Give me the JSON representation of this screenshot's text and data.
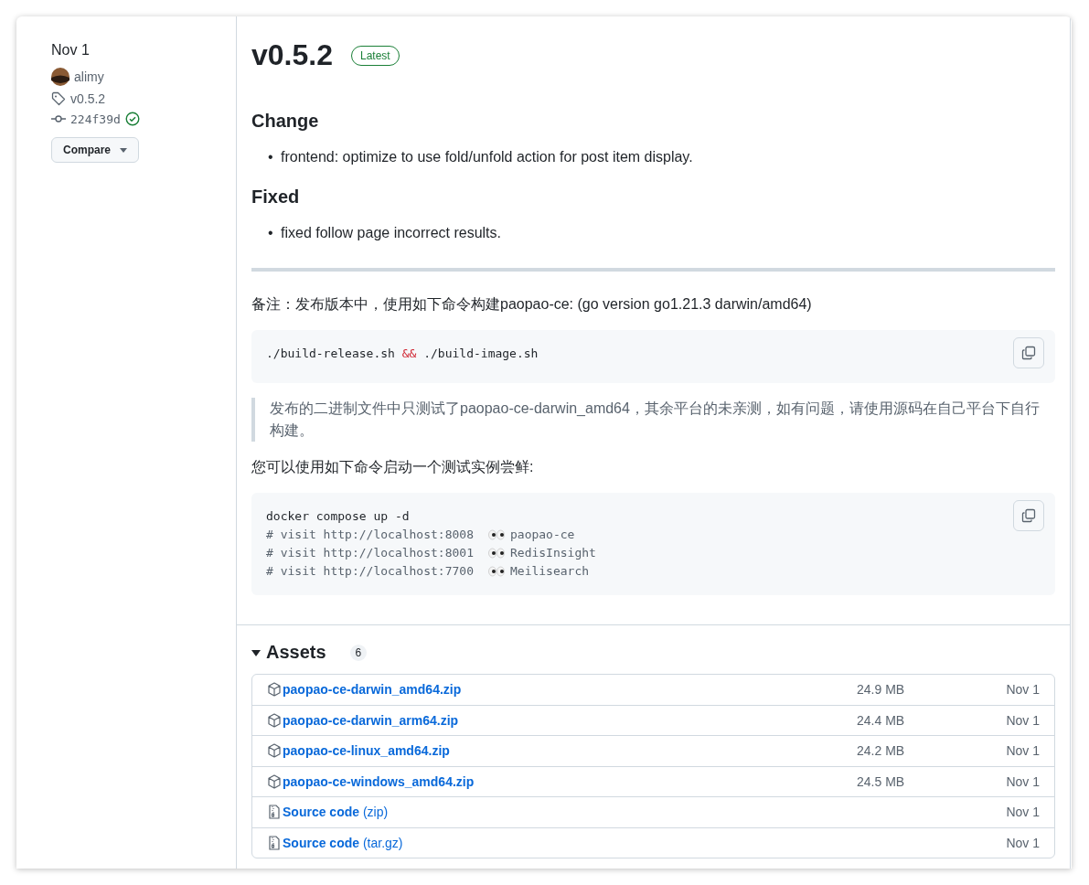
{
  "sidebar": {
    "date": "Nov 1",
    "author": "alimy",
    "tag": "v0.5.2",
    "commit": "224f39d",
    "verified": true,
    "compare_button": "Compare"
  },
  "release": {
    "title": "v0.5.2",
    "badge": "Latest",
    "sections": [
      {
        "heading": "Change",
        "items": [
          {
            "marker": "•",
            "text": "frontend: optimize to use fold/unfold action for post item display."
          }
        ]
      },
      {
        "heading": "Fixed",
        "items": [
          {
            "marker": "•",
            "text": "fixed follow page incorrect results."
          }
        ]
      }
    ],
    "note": "备注：发布版本中，使用如下命令构建paopao-ce: (go version go1.21.3 darwin/amd64)",
    "build_code": [
      {
        "kind": "plain",
        "text": "./build-release.sh "
      },
      {
        "kind": "operator",
        "text": "&&"
      },
      {
        "kind": "plain",
        "text": " ./build-image.sh"
      }
    ],
    "quote": "发布的二进制文件中只测试了paopao-ce-darwin_amd64，其余平台的未亲测，如有问题，请使用源码在自己平台下自行构建。",
    "try_text": "您可以使用如下命令启动一个测试实例尝鲜:",
    "try_code": [
      {
        "kind": "command",
        "text": "docker compose up -d"
      },
      {
        "kind": "comment",
        "text": "# visit http://localhost:8008",
        "target": "paopao-ce"
      },
      {
        "kind": "comment",
        "text": "# visit http://localhost:8001",
        "target": "RedisInsight"
      },
      {
        "kind": "comment",
        "text": "# visit http://localhost:7700",
        "target": "Meilisearch"
      }
    ]
  },
  "assets": {
    "title": "Assets",
    "expanded": true,
    "count": "6",
    "rows": [
      {
        "kind": "package",
        "name": "paopao-ce-darwin_amd64.zip",
        "size": "24.9 MB",
        "date": "Nov 1"
      },
      {
        "kind": "package",
        "name": "paopao-ce-darwin_arm64.zip",
        "size": "24.4 MB",
        "date": "Nov 1"
      },
      {
        "kind": "package",
        "name": "paopao-ce-linux_amd64.zip",
        "size": "24.2 MB",
        "date": "Nov 1"
      },
      {
        "kind": "package",
        "name": "paopao-ce-windows_amd64.zip",
        "size": "24.5 MB",
        "date": "Nov 1"
      },
      {
        "kind": "source",
        "name": "**Source code** (zip)",
        "date": "Nov 1"
      },
      {
        "kind": "source",
        "name": "**Source code** (tar.gz)",
        "date": "Nov 1"
      }
    ]
  }
}
